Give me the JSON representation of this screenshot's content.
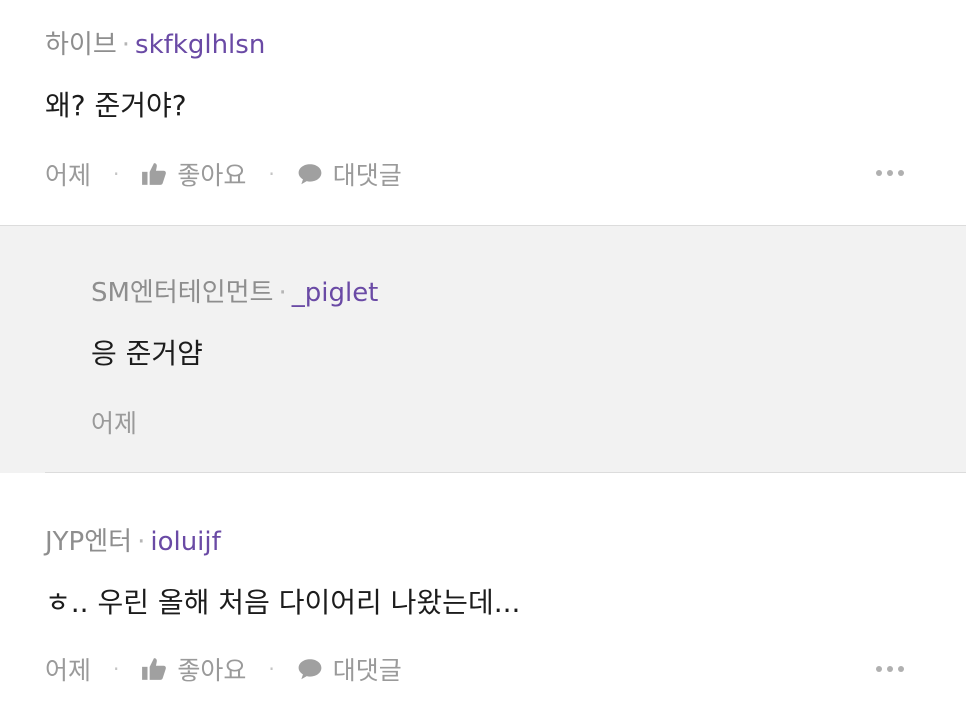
{
  "comments": [
    {
      "agency": "하이브",
      "separator": "·",
      "nickname": "skfkglhlsn",
      "text": "왜? 준거야?",
      "time": "어제",
      "like_label": "좋아요",
      "reply_label": "대댓글"
    },
    {
      "agency": "JYP엔터",
      "separator": "·",
      "nickname": "ioluijf",
      "text": "ㅎ.. 우린 올해 처음 다이어리 나왔는데...",
      "time": "어제",
      "like_label": "좋아요",
      "reply_label": "대댓글"
    }
  ],
  "reply": {
    "agency": "SM엔터테인먼트",
    "separator": "·",
    "nickname": "_piglet",
    "text": "응 준거얌",
    "time": "어제"
  },
  "action_separator": "·",
  "icons": [
    "thumbs-up-icon",
    "speech-bubble-icon",
    "more-options-icon"
  ],
  "colors": {
    "nickname": "#6a4aa5",
    "muted": "#8e8e8e",
    "reply_bg": "#f2f2f2"
  }
}
